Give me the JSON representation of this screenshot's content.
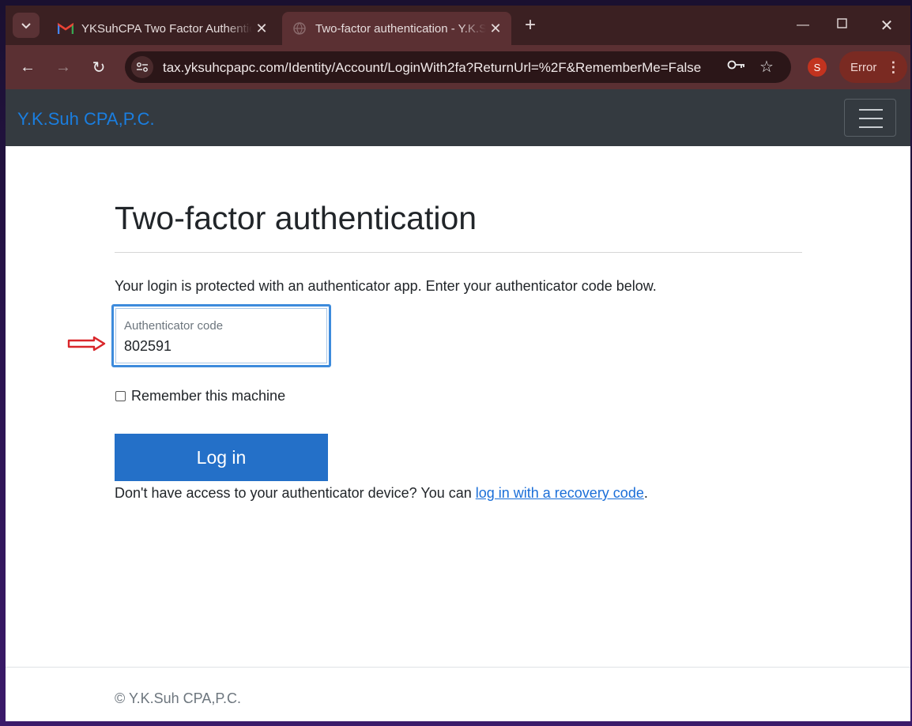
{
  "browser": {
    "tabs": [
      {
        "title": "YKSuhCPA Two Factor Authentication",
        "favicon": "gmail-icon"
      },
      {
        "title": "Two-factor authentication - Y.K.Suh CPA,P.C.",
        "favicon": "globe-icon"
      }
    ],
    "url": "tax.yksuhcpapc.com/Identity/Account/LoginWith2fa?ReturnUrl=%2F&RememberMe=False",
    "profile_initial": "S",
    "profile_color": "#c2331f",
    "error_label": "Error"
  },
  "site": {
    "brand": "Y.K.Suh CPA,P.C.",
    "brand_color": "#1a7ee0",
    "navbar_color": "#343a40"
  },
  "main": {
    "title": "Two-factor authentication",
    "intro": "Your login is protected with an authenticator app. Enter your authenticator code below.",
    "code_field": {
      "label": "Authenticator code",
      "value": "802591"
    },
    "remember_label": "Remember this machine",
    "remember_checked": false,
    "login_button": "Log in",
    "login_button_color": "#2470c8",
    "recovery_prefix": "Don't have access to your authenticator device? You can ",
    "recovery_link": "log in with a recovery code",
    "recovery_suffix": "."
  },
  "footer": {
    "text": "© Y.K.Suh CPA,P.C."
  }
}
